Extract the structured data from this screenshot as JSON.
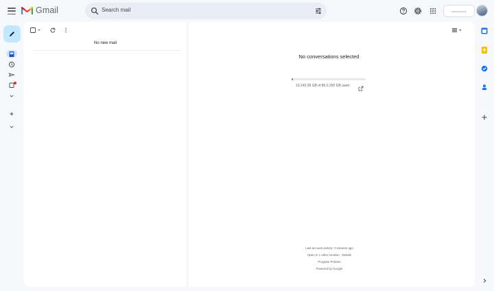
{
  "header": {
    "app_name": "Gmail",
    "search_placeholder": "Search mail",
    "account_label": "••••••••••••"
  },
  "list_pane": {
    "empty_text": "No new mail"
  },
  "reading_pane": {
    "empty_text": "No conversations selected",
    "storage": {
      "used_fraction": 0.02,
      "text": "10,145.28 GB of 86,0.260 GB used"
    }
  },
  "footer": {
    "activity": "Last account activity: 0 minutes ago",
    "location": "Open in 1 other location · Details",
    "policies": "Program Policies",
    "powered": "Powered by Google"
  },
  "colors": {
    "background": "#f6f8fc",
    "compose_bg": "#c2e7ff",
    "accent": "#0b57d0",
    "calendar": "#1a73e8",
    "keep": "#fbbc04",
    "tasks": "#1a73e8",
    "contacts": "#1a73e8"
  },
  "icons": {
    "menu": "hamburger-icon",
    "search": "search-icon",
    "filters": "tune-icon",
    "help": "help-icon",
    "settings": "gear-icon",
    "apps": "apps-grid-icon"
  }
}
